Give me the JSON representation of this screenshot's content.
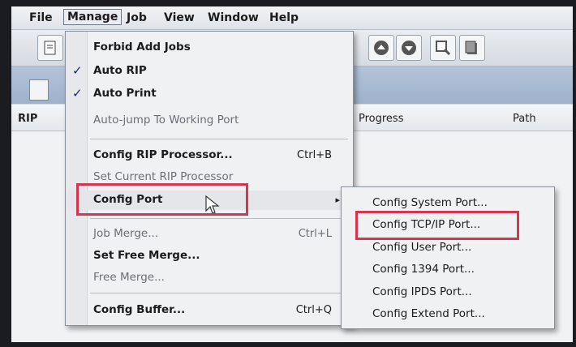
{
  "menubar": {
    "items": [
      "File",
      "Manage",
      "Job",
      "View",
      "Window",
      "Help"
    ]
  },
  "list": {
    "columns": [
      "RIP",
      "Progress",
      "Path"
    ]
  },
  "manage_menu": {
    "items": [
      {
        "label": "Forbid Add Jobs",
        "checked": false,
        "disabled": false,
        "shortcut": ""
      },
      {
        "label": "Auto RIP",
        "checked": true,
        "disabled": false,
        "shortcut": ""
      },
      {
        "label": "Auto Print",
        "checked": true,
        "disabled": false,
        "shortcut": ""
      },
      {
        "label": "Auto-jump To Working Port",
        "checked": false,
        "disabled": true,
        "shortcut": ""
      },
      {
        "label": "Config RIP Processor...",
        "checked": false,
        "disabled": false,
        "shortcut": "Ctrl+B"
      },
      {
        "label": "Set Current RIP Processor",
        "checked": false,
        "disabled": true,
        "shortcut": ""
      },
      {
        "label": "Config Port",
        "checked": false,
        "disabled": false,
        "shortcut": "",
        "submenu_arrow": "▸"
      },
      {
        "label": "Job Merge...",
        "checked": false,
        "disabled": true,
        "shortcut": "Ctrl+L"
      },
      {
        "label": "Set Free Merge...",
        "checked": false,
        "disabled": false,
        "shortcut": ""
      },
      {
        "label": "Free Merge...",
        "checked": false,
        "disabled": true,
        "shortcut": ""
      },
      {
        "label": "Config Buffer...",
        "checked": false,
        "disabled": false,
        "shortcut": "Ctrl+Q"
      }
    ],
    "check_mark": "✓"
  },
  "config_port_submenu": {
    "items": [
      "Config System Port...",
      "Config TCP/IP Port...",
      "Config User Port...",
      "Config 1394 Port...",
      "Config IPDS Port...",
      "Config Extend Port..."
    ]
  },
  "colors": {
    "highlight_box": "#d8334f",
    "menu_bg": "#f0f1f3"
  }
}
